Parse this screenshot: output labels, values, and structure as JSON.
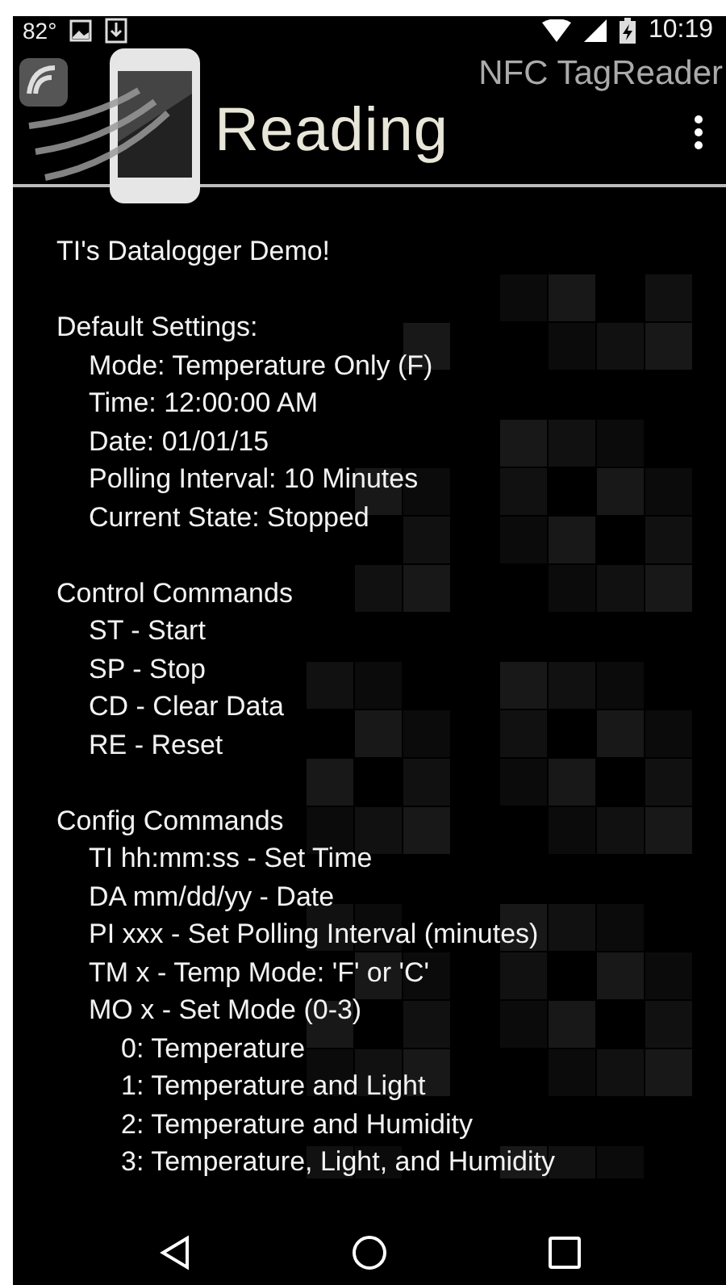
{
  "status_bar": {
    "temperature": "82°",
    "time": "10:19"
  },
  "app_bar": {
    "app_name": "NFC TagReader",
    "title": "Reading"
  },
  "content": [
    {
      "text": "TI's Datalogger Demo!"
    },
    {
      "text": "Default Settings:",
      "children": [
        {
          "text": "Mode: Temperature Only (F)"
        },
        {
          "text": "Time: 12:00:00 AM"
        },
        {
          "text": "Date: 01/01/15"
        },
        {
          "text": "Polling Interval: 10 Minutes"
        },
        {
          "text": "Current State: Stopped"
        }
      ]
    },
    {
      "text": "Control Commands",
      "children": [
        {
          "text": "ST - Start"
        },
        {
          "text": "SP - Stop"
        },
        {
          "text": "CD - Clear Data"
        },
        {
          "text": "RE - Reset"
        }
      ]
    },
    {
      "text": "Config Commands",
      "children": [
        {
          "text": "TI hh:mm:ss - Set Time"
        },
        {
          "text": "DA mm/dd/yy - Date"
        },
        {
          "text": "PI xxx - Set Polling Interval (minutes)"
        },
        {
          "text": "TM x - Temp Mode: 'F' or 'C'"
        },
        {
          "text": "MO x - Set Mode (0-3)",
          "children": [
            {
              "text": "0: Temperature"
            },
            {
              "text": "1: Temperature and Light"
            },
            {
              "text": "2: Temperature and Humidity"
            },
            {
              "text": "3: Temperature, Light, and Humidity"
            }
          ]
        }
      ]
    }
  ]
}
